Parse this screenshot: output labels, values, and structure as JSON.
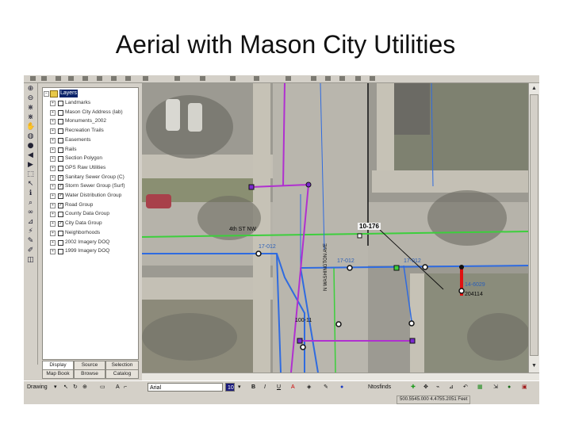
{
  "slide": {
    "title": "Aerial with Mason City Utilities"
  },
  "colors": {
    "water": "#2f6be0",
    "storm": "#b030d0",
    "road": "#3ccf3c",
    "lot": "#111111",
    "sanitary": "#e01010"
  },
  "toolbar_left": {
    "icons": [
      "zoom-in-icon",
      "zoom-out-icon",
      "fixed-zoom-in-icon",
      "fixed-zoom-out-icon",
      "pan-icon",
      "full-extent-icon",
      "globe-icon",
      "back-extent-icon",
      "forward-extent-icon",
      "select-features-icon",
      "select-elements-icon",
      "identify-icon",
      "find-icon",
      "measure-icon",
      "hyperlink-icon",
      "binoculars-icon",
      "edit-icon",
      "pencil-icon",
      "sketch-icon"
    ]
  },
  "toc": {
    "root_label": "Layers",
    "layers": [
      {
        "label": "Landmarks",
        "checked": false
      },
      {
        "label": "Mason City Address (lab)",
        "checked": false
      },
      {
        "label": "Monuments_2002",
        "checked": false
      },
      {
        "label": "Recreation Trails",
        "checked": false
      },
      {
        "label": "Easements",
        "checked": false
      },
      {
        "label": "Rails",
        "checked": false
      },
      {
        "label": "Section Polygon",
        "checked": false
      },
      {
        "label": "GPS Raw Utilities",
        "checked": false
      },
      {
        "label": "Sanitary Sewer Group (C)",
        "checked": true
      },
      {
        "label": "Storm Sewer Group (Surf)",
        "checked": true
      },
      {
        "label": "Water Distribution Group",
        "checked": true
      },
      {
        "label": "Road Group",
        "checked": true
      },
      {
        "label": "County Data Group",
        "checked": false
      },
      {
        "label": "City Data Group",
        "checked": true
      },
      {
        "label": "Neighborhoods",
        "checked": false
      },
      {
        "label": "2002 Imagery DOQ",
        "checked": false
      },
      {
        "label": "1999 Imagery DOQ",
        "checked": false
      }
    ],
    "tabs_row1": [
      "Display",
      "Source",
      "Selection"
    ],
    "tabs_row2": [
      "Map Book",
      "Browse",
      "Catalog"
    ]
  },
  "map": {
    "labels": {
      "street_name": "4th ST NW",
      "lot_id": "10-176",
      "pipe_1": "17-012",
      "pipe_2": "17-012",
      "pipe_3": "17-012",
      "pipe_4": "100-11",
      "sanitary_id": "14-6029",
      "sanitary_id_2": "204114",
      "street_vertical": "N WASHINGTON AVE"
    }
  },
  "drawbar": {
    "drawing_label": "Drawing",
    "font_name": "Arial",
    "font_size_hint": "10",
    "bold_label": "B",
    "italic_label": "I",
    "underline_label": "U",
    "text_label": "A",
    "dropdown_right": "Ntosfinds"
  },
  "status": {
    "coords": "500.5545.000 4.4755.2051 Feet"
  }
}
